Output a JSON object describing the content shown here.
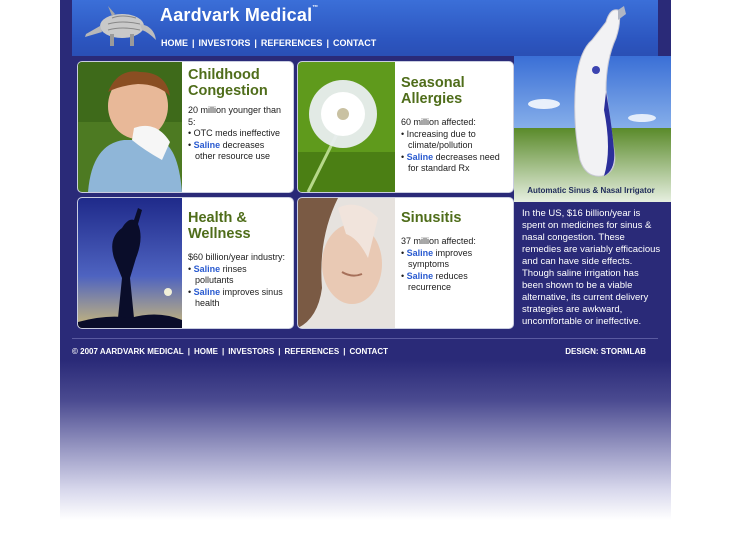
{
  "brand": {
    "name": "Aardvark Medical",
    "tm": "™"
  },
  "nav": [
    "HOME",
    "INVESTORS",
    "REFERENCES",
    "CONTACT"
  ],
  "cards": [
    {
      "title_l1": "Childhood",
      "title_l2": "Congestion",
      "intro": "20 million younger than 5:",
      "b1": "OTC meds ineffective",
      "b2_saline": "Saline",
      "b2_rest": " decreases other resource use"
    },
    {
      "title_l1": "Seasonal Allergies",
      "intro": "60 million affected:",
      "b1": "Increasing due to climate/pollution",
      "b2_saline": "Saline",
      "b2_rest": " decreases need for standard Rx"
    },
    {
      "title_l1": "Health & Wellness",
      "intro": "$60 billion/year industry:",
      "b1_saline": "Saline",
      "b1_rest": " rinses pollutants",
      "b2_saline": "Saline",
      "b2_rest": " improves sinus health"
    },
    {
      "title_l1": "Sinusitis",
      "intro": "37 million affected:",
      "b1_saline": "Saline",
      "b1_rest": " improves symptoms",
      "b2_saline": "Saline",
      "b2_rest": " reduces recurrence"
    }
  ],
  "device_caption": "Automatic Sinus & Nasal Irrigator",
  "info_text": "In the US, $16 billion/year is spent on medicines for sinus & nasal congestion. These remedies are variably efficacious and can have side effects. Though saline irrigation has been shown to be a viable alternative, its current delivery strategies are awkward, uncomfortable or ineffective.",
  "footer": {
    "copyright": "© 2007 AARDVARK MEDICAL",
    "links": [
      "HOME",
      "INVESTORS",
      "REFERENCES",
      "CONTACT"
    ],
    "credit": "DESIGN: STORMLAB"
  },
  "colors": {
    "page_bg": "#2a2a78",
    "header_bg": "#3b6fd8",
    "heading_green": "#4f6d1a",
    "saline_blue": "#2a5bd0"
  }
}
